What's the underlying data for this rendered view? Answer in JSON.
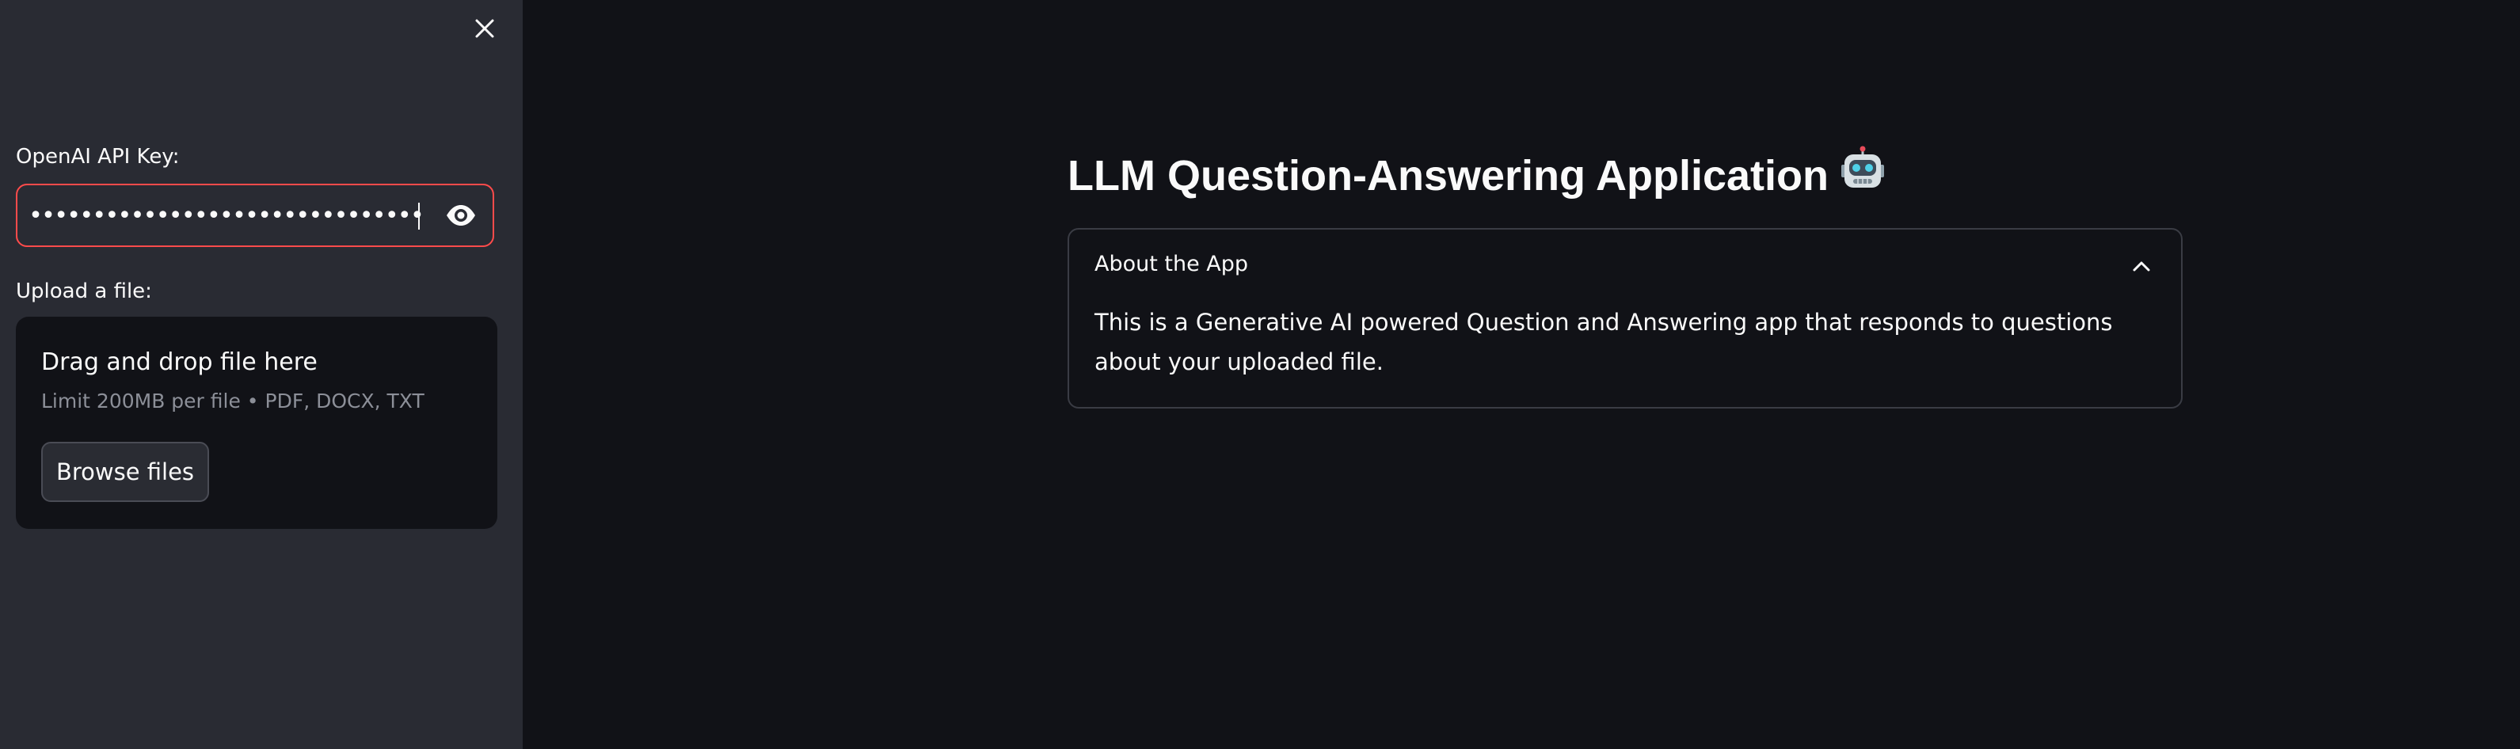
{
  "sidebar": {
    "api_key_label": "OpenAI API Key:",
    "api_key_value": "••••••••••••••••••••••••••••••••••••••••••••••••••••",
    "upload_label": "Upload a file:",
    "dropzone": {
      "title": "Drag and drop file here",
      "limits": "Limit 200MB per file • PDF, DOCX, TXT",
      "browse_label": "Browse files"
    }
  },
  "main": {
    "title": "LLM Question-Answering Application",
    "expander": {
      "title": "About the App",
      "body": "This is a Generative AI powered Question and Answering app that responds to questions about your uploaded file."
    }
  },
  "colors": {
    "sidebar_bg": "#292b33",
    "main_bg": "#111217",
    "accent": "#ff4b4b",
    "text": "#fafafa",
    "muted_text": "#8c8f98"
  },
  "icons": {
    "close": "close-icon",
    "show_password": "eye-icon",
    "expander_toggle": "chevron-up-icon",
    "title_emoji": "robot-icon"
  }
}
